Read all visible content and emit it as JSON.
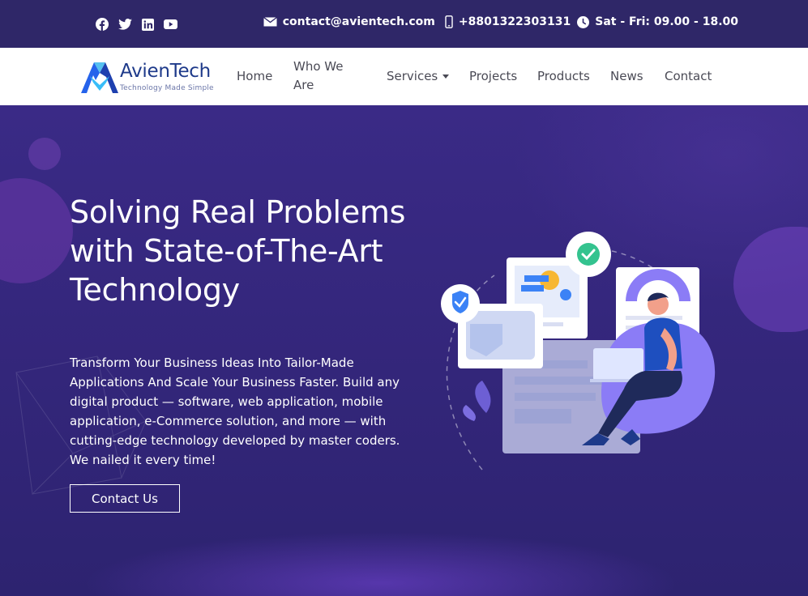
{
  "topbar": {
    "socials": [
      "facebook-icon",
      "twitter-icon",
      "linkedin-icon",
      "youtube-icon"
    ],
    "email": "contact@avientech.com",
    "phone": "+8801322303131",
    "hours": "Sat - Fri: 09.00 - 18.00"
  },
  "brand": {
    "name": "AvienTech",
    "tagline": "Technology Made Simple"
  },
  "nav": {
    "items": [
      "Home",
      "Who We Are",
      "Services",
      "Projects",
      "Products",
      "News",
      "Contact"
    ],
    "who_line1": "Who We",
    "who_line2": "Are"
  },
  "hero": {
    "title": "Solving Real Problems with State-of-The-Art Technology",
    "description": "Transform Your Business Ideas Into Tailor-Made Applications And Scale Your Business Faster. Build any digital product — software, web application, mobile application, e-Commerce solution, and more — with cutting-edge technology developed by master coders. We nailed it every time!",
    "cta": "Contact Us"
  },
  "colors": {
    "topbar_bg": "#2f2768",
    "hero_bg": "#33267a",
    "accent": "#5b5bd6",
    "check_green": "#34c38f",
    "shield_blue": "#3b82f6",
    "illustration_purple": "#8b7cf6"
  }
}
